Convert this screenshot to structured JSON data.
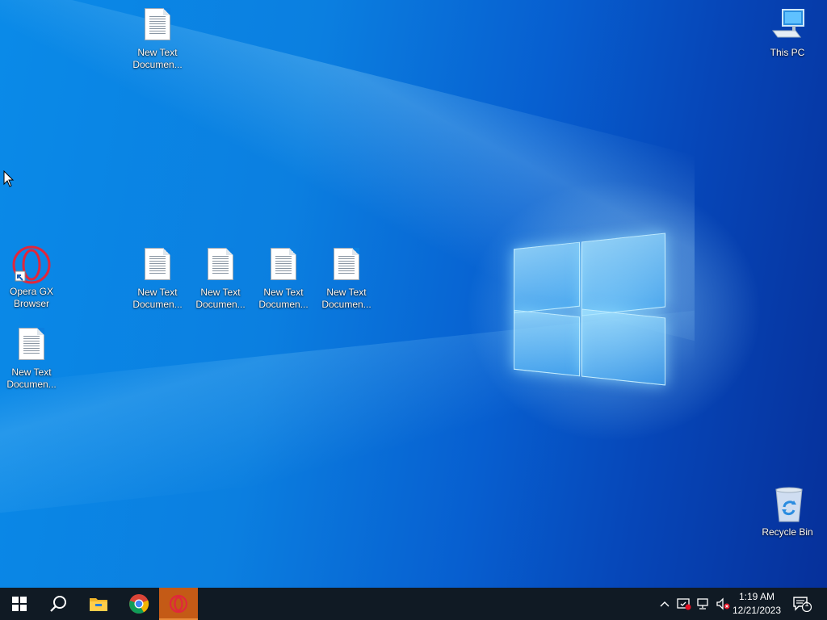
{
  "desktop": {
    "icons": [
      {
        "label": "New Text Documen...",
        "label_line1": "New Text",
        "label_line2": "Documen...",
        "kind": "text-file"
      },
      {
        "label": "This PC",
        "label_line1": "This PC",
        "label_line2": "",
        "kind": "computer"
      },
      {
        "label": "Opera GX Browser",
        "label_line1": "Opera GX",
        "label_line2": "Browser",
        "kind": "opera-gx-shortcut"
      },
      {
        "label": "New Text Documen...",
        "label_line1": "New Text",
        "label_line2": "Documen...",
        "kind": "text-file"
      },
      {
        "label": "New Text Documen...",
        "label_line1": "New Text",
        "label_line2": "Documen...",
        "kind": "text-file"
      },
      {
        "label": "New Text Documen...",
        "label_line1": "New Text",
        "label_line2": "Documen...",
        "kind": "text-file"
      },
      {
        "label": "New Text Documen...",
        "label_line1": "New Text",
        "label_line2": "Documen...",
        "kind": "text-file"
      },
      {
        "label": "New Text Documen...",
        "label_line1": "New Text",
        "label_line2": "Documen...",
        "kind": "text-file"
      },
      {
        "label": "Recycle Bin",
        "label_line1": "Recycle Bin",
        "label_line2": "",
        "kind": "recycle-bin"
      }
    ]
  },
  "taskbar": {
    "buttons": [
      {
        "name": "start-button",
        "icon": "windows-logo-icon"
      },
      {
        "name": "search-button",
        "icon": "search-icon"
      },
      {
        "name": "file-explorer-button",
        "icon": "folder-icon"
      },
      {
        "name": "chrome-button",
        "icon": "chrome-icon"
      },
      {
        "name": "opera-gx-button",
        "icon": "opera-gx-icon",
        "active": true
      }
    ],
    "tray": {
      "icons": [
        "chevron-up-icon",
        "security-icon",
        "network-icon",
        "volume-muted-icon"
      ],
      "time": "1:19 AM",
      "date": "12/21/2023",
      "notification_count": "1"
    }
  },
  "colors": {
    "taskbar_bg": "#101a24",
    "active_app": "#c45a16",
    "opera_red": "#e0273c",
    "chrome_red": "#db4437",
    "chrome_yellow": "#f4b400",
    "chrome_green": "#0f9d58",
    "chrome_blue": "#4285f4"
  }
}
